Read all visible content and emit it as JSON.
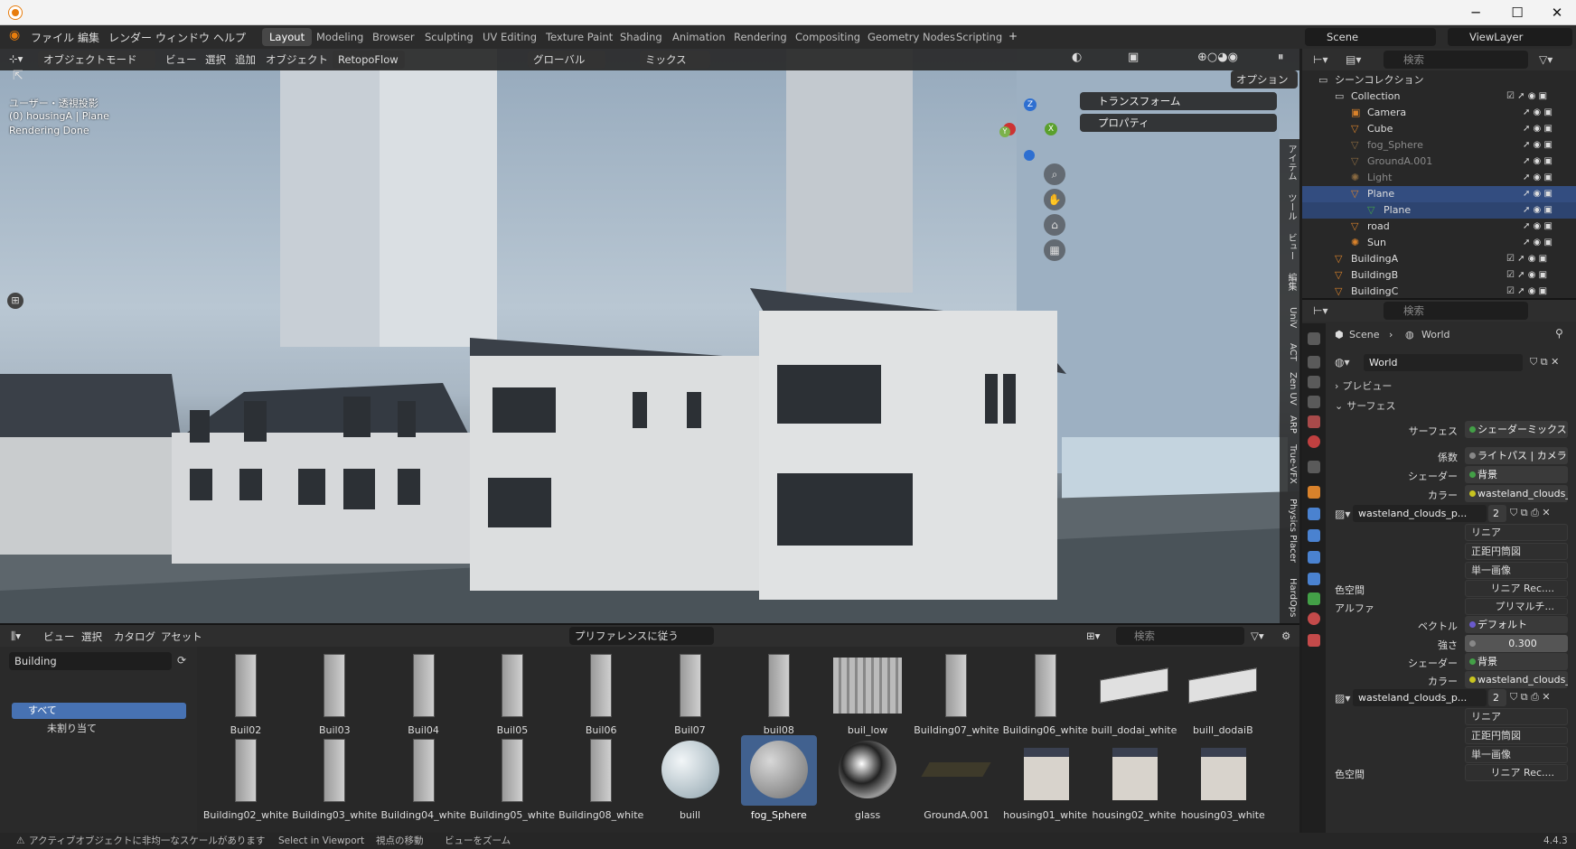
{
  "window": {
    "minimize": "─",
    "maximize": "☐",
    "close": "✕"
  },
  "menu": {
    "file": "ファイル",
    "edit": "編集",
    "render": "レンダー",
    "window": "ウィンドウ",
    "help": "ヘルプ"
  },
  "workspaces": [
    "Layout",
    "Modeling",
    "Browser",
    "Sculpting",
    "UV Editing",
    "Texture Paint",
    "Shading",
    "Animation",
    "Rendering",
    "Compositing",
    "Geometry Nodes",
    "Scripting"
  ],
  "add_workspace": "+",
  "scene": {
    "name": "Scene",
    "view_layer": "ViewLayer"
  },
  "viewport_header": {
    "mode": "オブジェクトモード",
    "view": "ビュー",
    "select": "選択",
    "add": "追加",
    "object": "オブジェクト",
    "addon": "RetopoFlow",
    "orientation": "グローバル",
    "snap": "ミックス",
    "options": "オプション"
  },
  "viewport_info": {
    "line1": "ユーザー・透視投影",
    "line2": "(0) housingA | Plane",
    "line3": "Rendering Done"
  },
  "gizmo": {
    "z": "Z",
    "y": "Y",
    "x": "X"
  },
  "npanel": {
    "transform": "トランスフォーム",
    "properties": "プロパティ"
  },
  "side_tabs": [
    "アイテム",
    "ツール",
    "ビュー",
    "編集",
    "UniV",
    "ACT",
    "Zen UV",
    "ARP",
    "True-VFX",
    "Physics Placer",
    "HardOps"
  ],
  "asset_browser": {
    "view": "ビュー",
    "select": "選択",
    "catalog": "カタログ",
    "asset": "アセット",
    "import": "プリファレンスに従う",
    "search_placeholder": "検索",
    "library": "Building",
    "cat_all": "すべて",
    "cat_unassigned": "未割り当て",
    "row1": [
      "Buil02",
      "Buil03",
      "Buil04",
      "Buil05",
      "Buil06",
      "Buil07",
      "buil08",
      "buil_low",
      "Building07_white",
      "Building06_white",
      "buill_dodai_white",
      "buill_dodaiB"
    ],
    "row2": [
      "Building02_white",
      "Building03_white",
      "Building04_white",
      "Building05_white",
      "Building08_white",
      "buill",
      "fog_Sphere",
      "glass",
      "GroundA.001",
      "housing01_white",
      "housing02_white",
      "housing03_white"
    ]
  },
  "outliner": {
    "search_placeholder": "検索",
    "root": "シーンコレクション",
    "collection": "Collection",
    "items": [
      "Camera",
      "Cube",
      "fog_Sphere",
      "GroundA.001",
      "Light",
      "Plane",
      "Plane",
      "road",
      "Sun",
      "BuildingA",
      "BuildingB",
      "BuildingC"
    ]
  },
  "properties": {
    "search_placeholder": "検索",
    "bc_scene": "Scene",
    "bc_world": "World",
    "world_name": "World",
    "preview": "プレビュー",
    "surface_panel": "サーフェス",
    "surface_label": "サーフェス",
    "surface_value": "シェーダーミックス",
    "fac_label": "係数",
    "fac_value": "ライトパス | カメラレイ",
    "shader_label": "シェーダー",
    "shader_value": "背景",
    "color_label": "カラー",
    "color_value": "wasteland_clouds_p...",
    "image_name": "wasteland_clouds_p...",
    "users": "2",
    "interp": "リニア",
    "proj": "正距円筒図",
    "source": "単一画像",
    "colorspace_label": "色空間",
    "colorspace_value": "リニア Rec....",
    "alpha_label": "アルファ",
    "alpha_value": "プリマルチ...",
    "vector_label": "ベクトル",
    "vector_value": "デフォルト",
    "strength_label": "強さ",
    "strength_value": "0.300",
    "shader2_label": "シェーダー",
    "shader2_value": "背景",
    "color2_label": "カラー",
    "color2_value": "wasteland_clouds_p...",
    "image2_name": "wasteland_clouds_p...",
    "users2": "2",
    "interp2": "リニア",
    "proj2": "正距円筒図",
    "source2": "単一画像",
    "colorspace2_label": "色空間",
    "colorspace2_value": "リニア Rec...."
  },
  "status": {
    "warning": "アクティブオブジェクトに非均一なスケールがあります",
    "select": "Select in Viewport",
    "move": "視点の移動",
    "zoom": "ビューをズーム",
    "version": "4.4.3"
  },
  "colors": {
    "accent": "#4772b3",
    "selected_row": "#334d80",
    "orange": "#e87d0d"
  }
}
